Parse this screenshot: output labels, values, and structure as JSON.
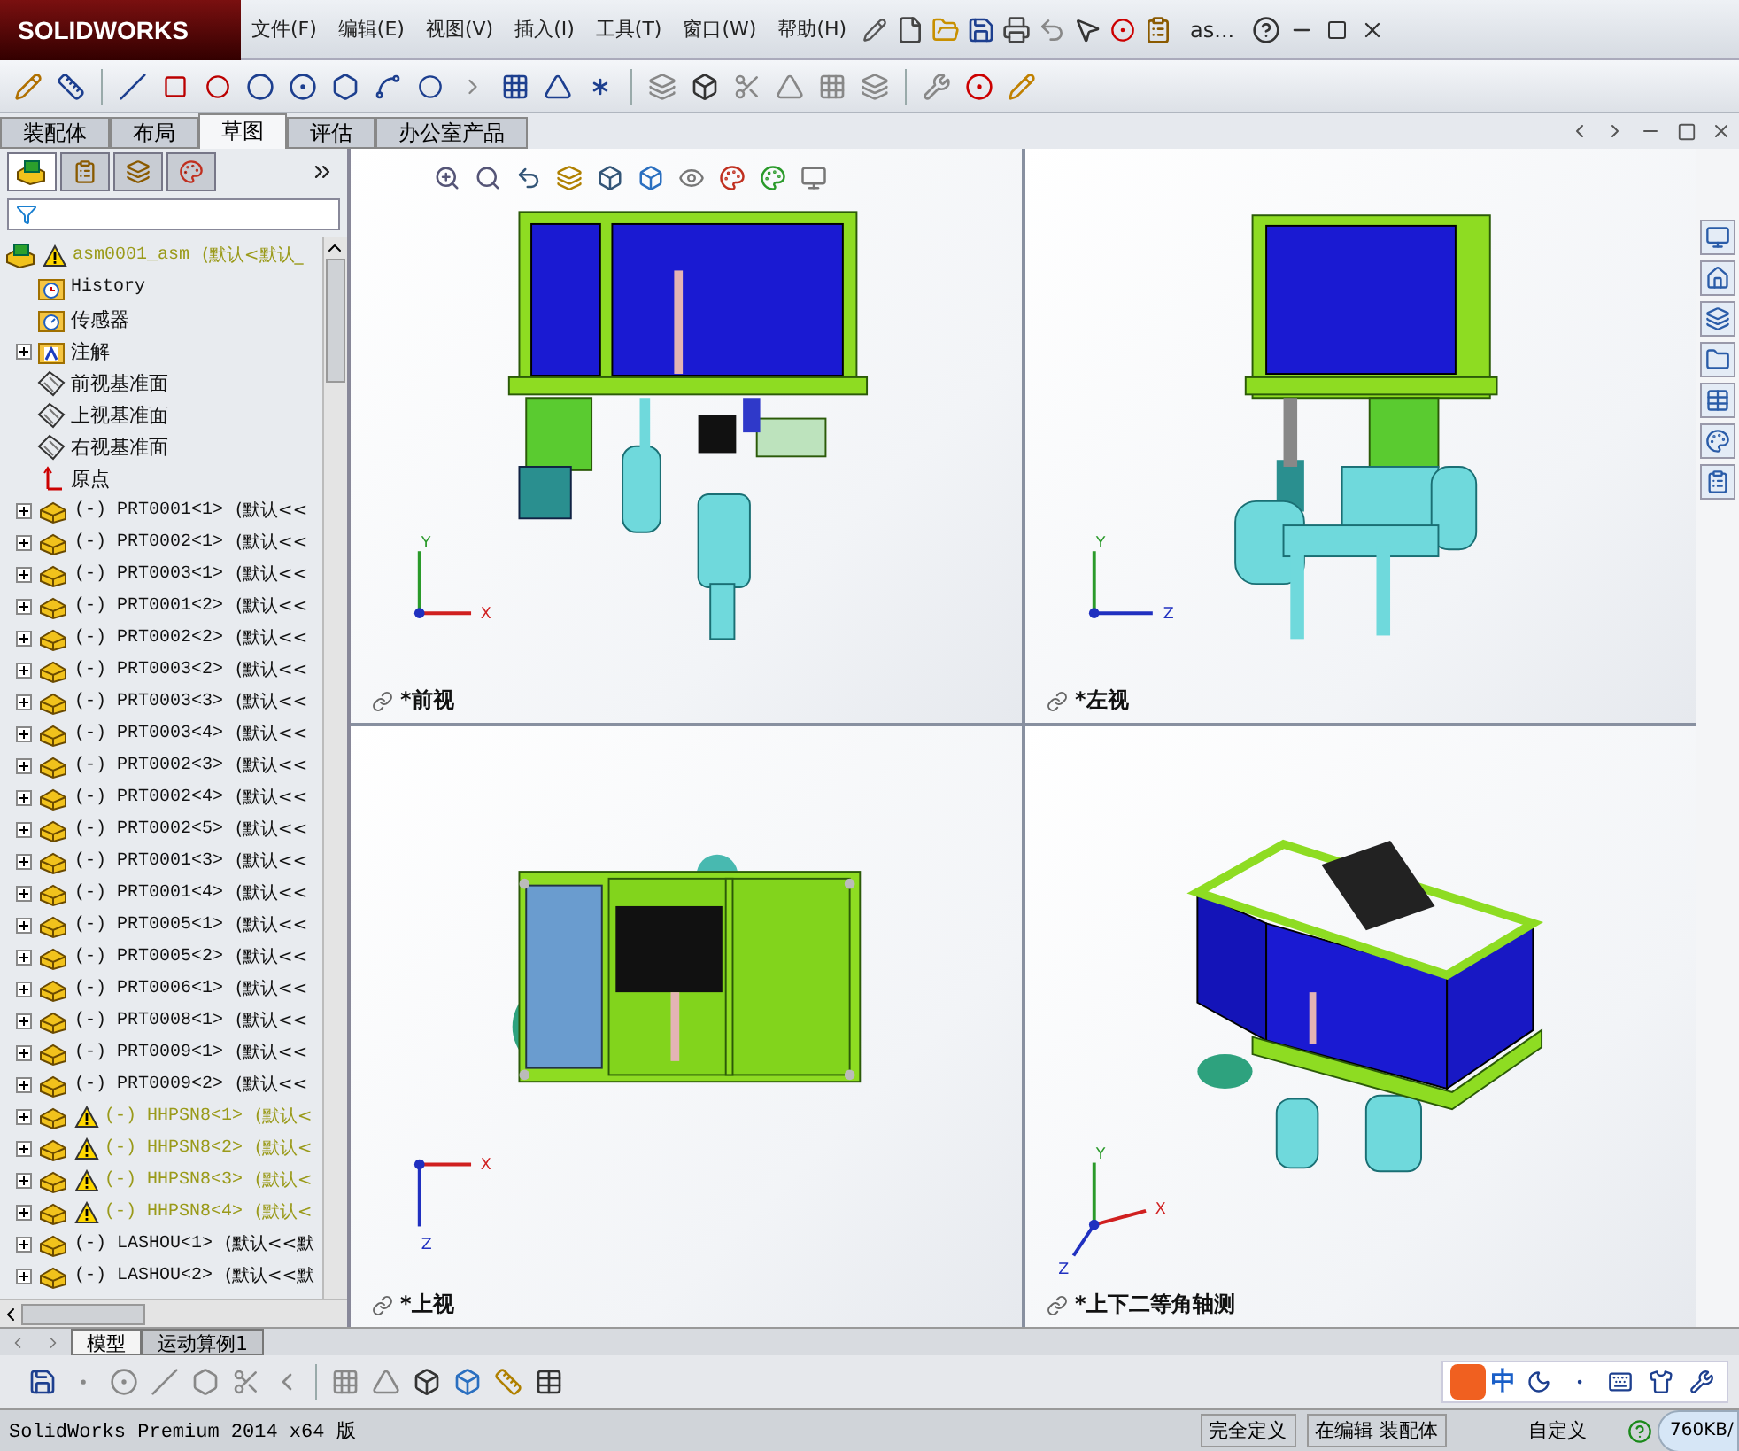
{
  "app": {
    "logo": "SOLIDWORKS",
    "menus": [
      "文件(F)",
      "编辑(E)",
      "视图(V)",
      "插入(I)",
      "工具(T)",
      "窗口(W)",
      "帮助(H)"
    ],
    "document_title": "as..."
  },
  "command_tabs": [
    {
      "label": "装配体",
      "selected": false
    },
    {
      "label": "布局",
      "selected": false
    },
    {
      "label": "草图",
      "selected": true
    },
    {
      "label": "评估",
      "selected": false
    },
    {
      "label": "办公室产品",
      "selected": false
    }
  ],
  "feature_tree": {
    "root": {
      "name": "asm0001_asm",
      "config": "(默认<默认_",
      "warning": true,
      "children": [
        {
          "kind": "history",
          "name": "History"
        },
        {
          "kind": "sensor",
          "name": "传感器"
        },
        {
          "kind": "annotation",
          "name": "注解",
          "expanded": false
        },
        {
          "kind": "plane",
          "name": "前视基准面"
        },
        {
          "kind": "plane",
          "name": "上视基准面"
        },
        {
          "kind": "plane",
          "name": "右视基准面"
        },
        {
          "kind": "origin",
          "name": "原点"
        },
        {
          "kind": "part",
          "name": "(-) PRT0001<1>",
          "config": "(默认<<",
          "warning": false,
          "expanded": false
        },
        {
          "kind": "part",
          "name": "(-) PRT0002<1>",
          "config": "(默认<<",
          "warning": false,
          "expanded": false
        },
        {
          "kind": "part",
          "name": "(-) PRT0003<1>",
          "config": "(默认<<",
          "warning": false,
          "expanded": false
        },
        {
          "kind": "part",
          "name": "(-) PRT0001<2>",
          "config": "(默认<<",
          "warning": false,
          "expanded": false
        },
        {
          "kind": "part",
          "name": "(-) PRT0002<2>",
          "config": "(默认<<",
          "warning": false,
          "expanded": false
        },
        {
          "kind": "part",
          "name": "(-) PRT0003<2>",
          "config": "(默认<<",
          "warning": false,
          "expanded": false
        },
        {
          "kind": "part",
          "name": "(-) PRT0003<3>",
          "config": "(默认<<",
          "warning": false,
          "expanded": false
        },
        {
          "kind": "part",
          "name": "(-) PRT0003<4>",
          "config": "(默认<<",
          "warning": false,
          "expanded": false
        },
        {
          "kind": "part",
          "name": "(-) PRT0002<3>",
          "config": "(默认<<",
          "warning": false,
          "expanded": false
        },
        {
          "kind": "part",
          "name": "(-) PRT0002<4>",
          "config": "(默认<<",
          "warning": false,
          "expanded": false
        },
        {
          "kind": "part",
          "name": "(-) PRT0002<5>",
          "config": "(默认<<",
          "warning": false,
          "expanded": false
        },
        {
          "kind": "part",
          "name": "(-) PRT0001<3>",
          "config": "(默认<<",
          "warning": false,
          "expanded": false
        },
        {
          "kind": "part",
          "name": "(-) PRT0001<4>",
          "config": "(默认<<",
          "warning": false,
          "expanded": false
        },
        {
          "kind": "part",
          "name": "(-) PRT0005<1>",
          "config": "(默认<<",
          "warning": false,
          "expanded": false
        },
        {
          "kind": "part",
          "name": "(-) PRT0005<2>",
          "config": "(默认<<",
          "warning": false,
          "expanded": false
        },
        {
          "kind": "part",
          "name": "(-) PRT0006<1>",
          "config": "(默认<<",
          "warning": false,
          "expanded": false
        },
        {
          "kind": "part",
          "name": "(-) PRT0008<1>",
          "config": "(默认<<",
          "warning": false,
          "expanded": false
        },
        {
          "kind": "part",
          "name": "(-) PRT0009<1>",
          "config": "(默认<<",
          "warning": false,
          "expanded": false
        },
        {
          "kind": "part",
          "name": "(-) PRT0009<2>",
          "config": "(默认<<",
          "warning": false,
          "expanded": false
        },
        {
          "kind": "part",
          "name": "(-) HHPSN8<1>",
          "config": "(默认<",
          "warning": true,
          "expanded": false
        },
        {
          "kind": "part",
          "name": "(-) HHPSN8<2>",
          "config": "(默认<",
          "warning": true,
          "expanded": false
        },
        {
          "kind": "part",
          "name": "(-) HHPSN8<3>",
          "config": "(默认<",
          "warning": true,
          "expanded": false
        },
        {
          "kind": "part",
          "name": "(-) HHPSN8<4>",
          "config": "(默认<",
          "warning": true,
          "expanded": false
        },
        {
          "kind": "part",
          "name": "(-) LASHOU<1>",
          "config": "(默认<<默",
          "warning": false,
          "expanded": false
        },
        {
          "kind": "part",
          "name": "(-) LASHOU<2>",
          "config": "(默认<<默",
          "warning": false,
          "expanded": false
        }
      ]
    }
  },
  "viewports": [
    {
      "kind": "front",
      "label": "*前视",
      "axes": [
        "Y",
        "X"
      ]
    },
    {
      "kind": "left",
      "label": "*左视",
      "axes": [
        "Y",
        "Z"
      ]
    },
    {
      "kind": "top",
      "label": "*上视",
      "axes": [
        "X",
        "Z"
      ]
    },
    {
      "kind": "iso",
      "label": "*上下二等角轴测",
      "axes": [
        "Y",
        "X",
        "Z"
      ]
    }
  ],
  "bottom_tabs": [
    {
      "label": "模型",
      "selected": true
    },
    {
      "label": "运动算例1",
      "selected": false
    }
  ],
  "ime": {
    "mode": "中"
  },
  "status_bar": {
    "product": "SolidWorks Premium 2014 x64 版",
    "fields": [
      "完全定义",
      "在编辑 装配体",
      "自定义"
    ],
    "network": "760KB/"
  }
}
